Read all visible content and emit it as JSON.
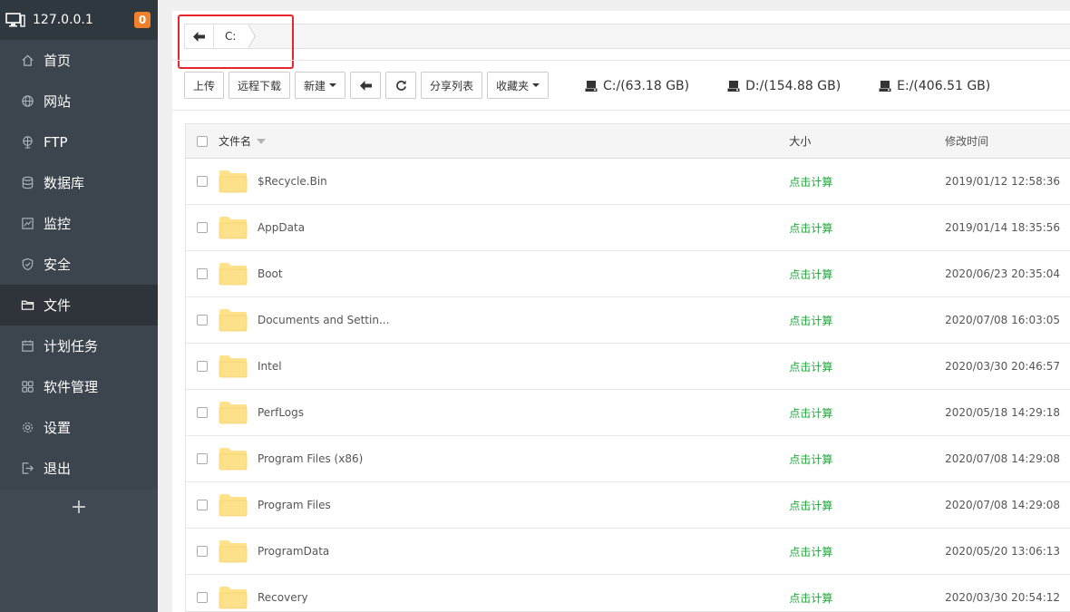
{
  "sidebar": {
    "host": "127.0.0.1",
    "badge": "0",
    "items": [
      {
        "label": "首页",
        "icon": "home-icon"
      },
      {
        "label": "网站",
        "icon": "globe-icon"
      },
      {
        "label": "FTP",
        "icon": "ftp-icon"
      },
      {
        "label": "数据库",
        "icon": "database-icon"
      },
      {
        "label": "监控",
        "icon": "monitor-icon"
      },
      {
        "label": "安全",
        "icon": "shield-icon"
      },
      {
        "label": "文件",
        "icon": "folder-icon",
        "active": true
      },
      {
        "label": "计划任务",
        "icon": "calendar-icon"
      },
      {
        "label": "软件管理",
        "icon": "grid-icon"
      },
      {
        "label": "设置",
        "icon": "gear-icon"
      },
      {
        "label": "退出",
        "icon": "logout-icon"
      }
    ],
    "add": "+"
  },
  "breadcrumb": {
    "path": "C:"
  },
  "toolbar": {
    "upload": "上传",
    "remote_download": "远程下载",
    "new": "新建",
    "share_list": "分享列表",
    "favorites": "收藏夹"
  },
  "disks": [
    {
      "label": "C:/(63.18 GB)"
    },
    {
      "label": "D:/(154.88 GB)"
    },
    {
      "label": "E:/(406.51 GB)"
    }
  ],
  "table": {
    "headers": {
      "name": "文件名",
      "size": "大小",
      "time": "修改时间"
    },
    "rows": [
      {
        "name": "$Recycle.Bin",
        "size": "点击计算",
        "time": "2019/01/12 12:58:36"
      },
      {
        "name": "AppData",
        "size": "点击计算",
        "time": "2019/01/14 18:35:56"
      },
      {
        "name": "Boot",
        "size": "点击计算",
        "time": "2020/06/23 20:35:04"
      },
      {
        "name": "Documents and Settin...",
        "size": "点击计算",
        "time": "2020/07/08 16:03:05"
      },
      {
        "name": "Intel",
        "size": "点击计算",
        "time": "2020/03/30 20:46:57"
      },
      {
        "name": "PerfLogs",
        "size": "点击计算",
        "time": "2020/05/18 14:29:18"
      },
      {
        "name": "Program Files (x86)",
        "size": "点击计算",
        "time": "2020/07/08 14:29:08"
      },
      {
        "name": "Program Files",
        "size": "点击计算",
        "time": "2020/07/08 14:29:08"
      },
      {
        "name": "ProgramData",
        "size": "点击计算",
        "time": "2020/05/20 13:06:13"
      },
      {
        "name": "Recovery",
        "size": "点击计算",
        "time": "2020/03/30 20:54:12"
      }
    ]
  },
  "colors": {
    "sidebar_bg": "#3c444d",
    "accent_green": "#20a53a",
    "badge_orange": "#f0802a",
    "highlight_red": "#e8262b"
  }
}
